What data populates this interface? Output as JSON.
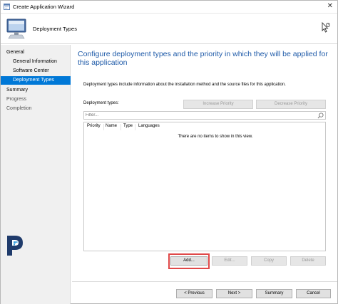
{
  "window": {
    "title": "Create Application Wizard",
    "close_glyph": "✕"
  },
  "header": {
    "heading": "Deployment Types"
  },
  "nav": {
    "items": [
      {
        "label": "General"
      },
      {
        "label": "General Information"
      },
      {
        "label": "Software Center"
      },
      {
        "label": "Deployment Types"
      },
      {
        "label": "Summary"
      },
      {
        "label": "Progress"
      },
      {
        "label": "Completion"
      }
    ]
  },
  "main": {
    "title": "Configure deployment types and the priority in which they will be applied for this application",
    "description": "Deployment types include information about the installation method and the source files for this application.",
    "deployment_types_label": "Deployment types:",
    "increase_priority_label": "Increase Priority",
    "decrease_priority_label": "Decrease Priority",
    "filter_placeholder": "Filter...",
    "columns": [
      "Priority",
      "Name",
      "Type",
      "Languages"
    ],
    "empty_message": "There are no items to show in this view.",
    "add_label": "Add...",
    "edit_label": "Edit...",
    "copy_label": "Copy",
    "delete_label": "Delete"
  },
  "footer": {
    "previous_label": "< Previous",
    "next_label": "Next >",
    "summary_label": "Summary",
    "cancel_label": "Cancel"
  },
  "colors": {
    "accent": "#0078d7",
    "title_blue": "#1e5aa8",
    "highlight_red": "#e04848"
  },
  "icons": {
    "app": "wizard-window-icon",
    "wizard": "computer-monitor-icon",
    "help": "help-cursor-icon",
    "search": "search-icon",
    "logo": "brand-logo-icon"
  }
}
